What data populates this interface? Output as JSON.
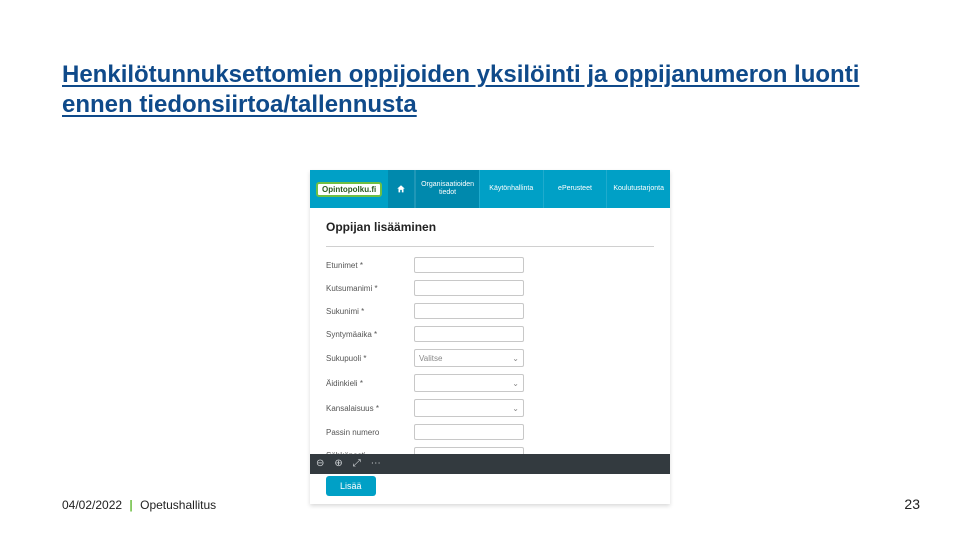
{
  "title": "Henkilötunnuksettomien oppijoiden yksilöinti ja oppijanumeron luonti ennen tiedonsiirtoa/tallennusta",
  "screenshot": {
    "brand": "Opintopolku.fi",
    "nav": {
      "home_icon": "home-icon",
      "items": [
        {
          "label": "Organisaatioiden tiedot",
          "active": true
        },
        {
          "label": "Käytönhallinta",
          "active": false
        },
        {
          "label": "ePerusteet",
          "active": false
        },
        {
          "label": "Koulutustarjonta",
          "active": false
        }
      ]
    },
    "form": {
      "heading": "Oppijan lisääminen",
      "fields": [
        {
          "label": "Etunimet",
          "required": true,
          "type": "text"
        },
        {
          "label": "Kutsumanimi",
          "required": true,
          "type": "text"
        },
        {
          "label": "Sukunimi",
          "required": true,
          "type": "text"
        },
        {
          "label": "Syntymäaika",
          "required": true,
          "type": "text"
        },
        {
          "label": "Sukupuoli",
          "required": true,
          "type": "select",
          "value": "Valitse"
        },
        {
          "label": "Äidinkieli",
          "required": true,
          "type": "select",
          "value": ""
        },
        {
          "label": "Kansalaisuus",
          "required": true,
          "type": "select",
          "value": ""
        },
        {
          "label": "Passin numero",
          "required": false,
          "type": "text"
        },
        {
          "label": "Sähköposti",
          "required": false,
          "type": "text"
        }
      ],
      "submit_label": "Lisää"
    }
  },
  "toolbar": {
    "icons": [
      "magnify-minus-icon",
      "magnify-plus-icon",
      "expand-icon",
      "more-icon"
    ]
  },
  "footer": {
    "date": "04/02/2022",
    "org": "Opetushallitus"
  },
  "page_number": "23"
}
